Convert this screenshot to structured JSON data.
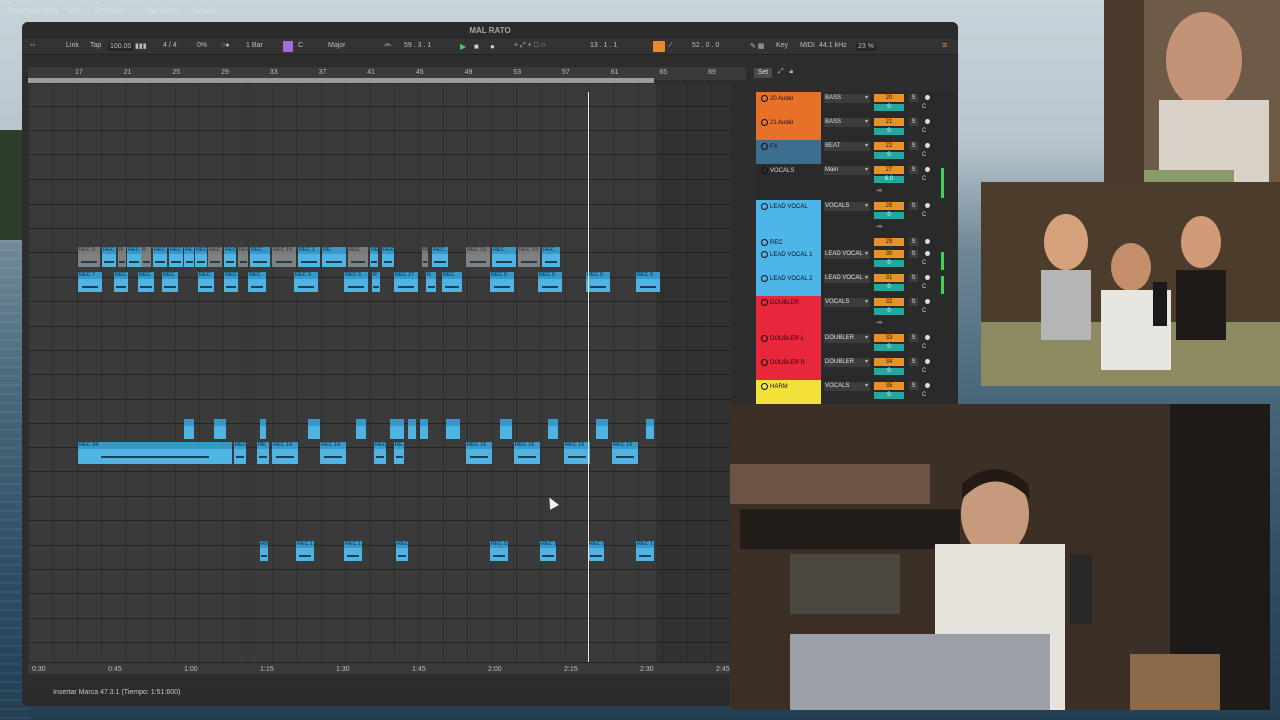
{
  "window": {
    "title": "MAL RATO"
  },
  "toolbar": {
    "link": "Link",
    "tap": "Tap",
    "tempo": "100.00",
    "signature": "4 / 4",
    "percent": "0%",
    "quantize": "1 Bar",
    "key": "C",
    "scale": "Major",
    "position": "59 .  3 .  1",
    "loop_start": "13 .  1 .  1",
    "loop_length": "52 .  0 .  0",
    "key_label": "Key",
    "midi_label": "MIDI",
    "sample_rate": "44.1 kHz",
    "cpu": "23 %"
  },
  "ruler": {
    "bars": [
      "17",
      "21",
      "25",
      "29",
      "33",
      "37",
      "41",
      "45",
      "49",
      "53",
      "57",
      "61",
      "65",
      "69"
    ]
  },
  "time_ruler": {
    "labels": [
      "0:30",
      "0:45",
      "1:00",
      "1:15",
      "1:30",
      "1:45",
      "2:00",
      "2:15",
      "2:30",
      "2:45"
    ]
  },
  "clips": {
    "row1": [
      "REC 5",
      "REC 1",
      "R",
      "REC",
      "R",
      "REC",
      "REC 1",
      "RE",
      "REC",
      "REC 1",
      "REC 1",
      "REC 15",
      "REC",
      "REC 15",
      "REC 1",
      "RE",
      "REC",
      "REC 15",
      "REC",
      "REC 15",
      "REC",
      "REC 15",
      "REC",
      "REC 15",
      "REC"
    ],
    "row2": [
      "REC 7",
      "REC",
      "REC",
      "REC",
      "REC",
      "REC",
      "REC",
      "REC 5",
      "REC 5",
      "R",
      "REC 27",
      "R",
      "REC",
      "REC 5",
      "REC 5",
      "REC 5",
      "REC 5"
    ],
    "row3": [
      "REC 34",
      "REC",
      "RE",
      "REC 16",
      "REC 16",
      "REC",
      "RE",
      "REC 16",
      "REC 16",
      "REC 16",
      "REC 16"
    ],
    "row4": [
      "REC 1",
      "REC 1",
      "REC 1",
      "REC 1",
      "REC 5",
      "REC 1",
      "REC 5",
      "REC 1"
    ]
  },
  "mixer": {
    "set_label": "Set",
    "tracks": [
      {
        "name": "20 Audio",
        "group": "BASS",
        "num": "20",
        "vol": "0",
        "color": "#e8712a"
      },
      {
        "name": "21 Audio",
        "group": "BASS",
        "num": "21",
        "vol": "0",
        "color": "#e8712a"
      },
      {
        "name": "FX",
        "group": "BEAT",
        "num": "22",
        "vol": "0",
        "color": "#3c6f8f"
      },
      {
        "name": "VOCALS",
        "group": "Main",
        "num": "27",
        "vol": "6.0",
        "color": "#2a2a2a"
      },
      {
        "name": "LEAD VOCAL",
        "group": "VOCALS",
        "num": "28",
        "vol": "0",
        "color": "#4db5e8"
      },
      {
        "name": "REC",
        "group": "",
        "num": "29",
        "vol": "",
        "color": "#4db5e8"
      },
      {
        "name": "LEAD VOCAL 1",
        "group": "LEAD VOCAL",
        "num": "30",
        "vol": "0",
        "color": "#4db5e8"
      },
      {
        "name": "LEAD VOCAL 2",
        "group": "LEAD VOCAL",
        "num": "31",
        "vol": "0",
        "color": "#4db5e8"
      },
      {
        "name": "DOUBLER",
        "group": "VOCALS",
        "num": "32",
        "vol": "0",
        "color": "#e8283a"
      },
      {
        "name": "DOUBLER L",
        "group": "DOUBLER",
        "num": "33",
        "vol": "0",
        "color": "#e8283a"
      },
      {
        "name": "DOUBLER R",
        "group": "DOUBLER",
        "num": "34",
        "vol": "0",
        "color": "#e8283a"
      },
      {
        "name": "HARM",
        "group": "VOCALS",
        "num": "35",
        "vol": "0",
        "color": "#f2e23a"
      }
    ],
    "solo": "S",
    "center": "C",
    "neg_inf": "-∞"
  },
  "status": {
    "text": "Insertar Marca 47.3.1 (Tiempo: 1:51:600)"
  },
  "colors": {
    "clip": "#4fb3e3",
    "accent": "#e68a2b"
  }
}
